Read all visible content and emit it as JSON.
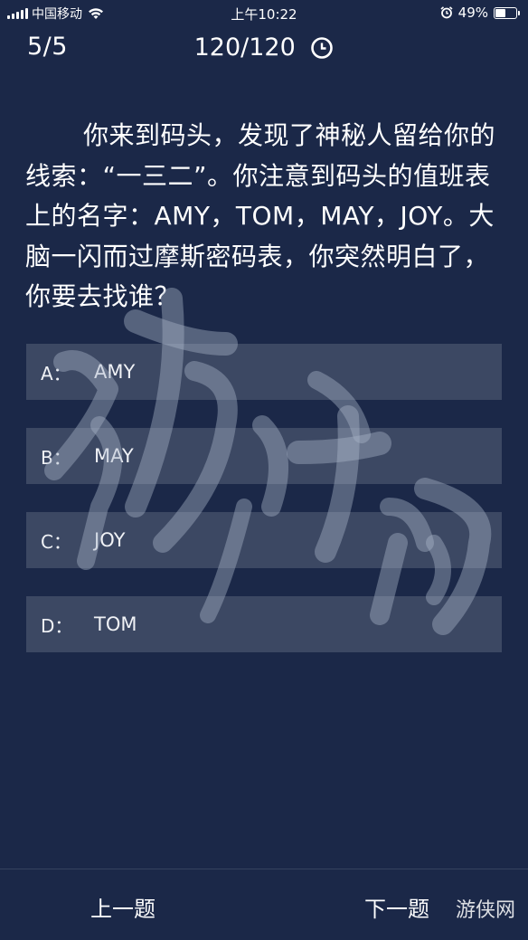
{
  "status_bar": {
    "carrier": "中国移动",
    "time": "上午10:22",
    "battery_percent": "49%",
    "battery_level": 0.49,
    "icons": [
      "signal-icon",
      "wifi-icon",
      "alarm-icon",
      "battery-icon"
    ]
  },
  "header": {
    "progress": "5/5",
    "timer": "120/120",
    "timer_icon": "clock-icon"
  },
  "question": {
    "text": "你来到码头，发现了神秘人留给你的线索：“一三二”。你注意到码头的值班表上的名字：AMY，TOM，MAY，JOY。大脑一闪而过摩斯密码表，你突然明白了，你要去找谁？"
  },
  "options": [
    {
      "key": "A：",
      "text": "AMY"
    },
    {
      "key": "B：",
      "text": "MAY"
    },
    {
      "key": "C：",
      "text": "JOY"
    },
    {
      "key": "D：",
      "text": "TOM"
    }
  ],
  "nav": {
    "prev_label": "上一题",
    "next_label": "下一题"
  },
  "watermark": {
    "text": "游侠网",
    "small_text": "游侠网"
  },
  "colors": {
    "background": "#1b2848",
    "option_bg": "rgba(255,255,255,0.15)",
    "text": "#ffffff"
  }
}
